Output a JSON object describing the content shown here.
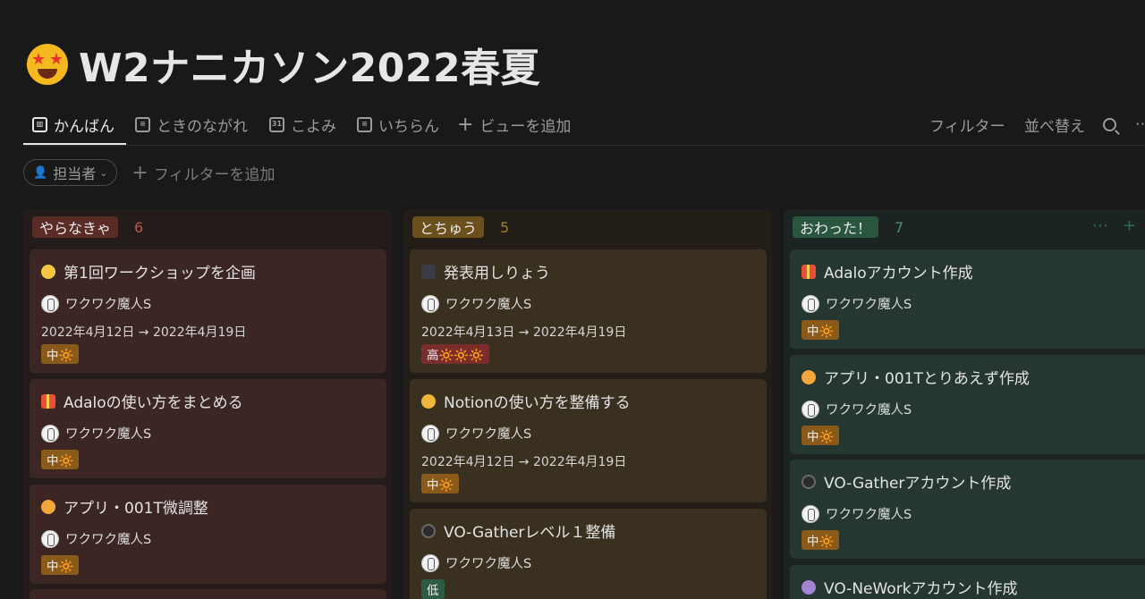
{
  "page": {
    "title": "W2ナニカソン2022春夏",
    "icon": "star-struck-emoji-icon"
  },
  "views": {
    "tabs": [
      {
        "label": "かんばん",
        "icon": "board-icon",
        "active": true
      },
      {
        "label": "ときのながれ",
        "icon": "timeline-icon"
      },
      {
        "label": "こよみ",
        "icon": "calendar-icon"
      },
      {
        "label": "いちらん",
        "icon": "list-icon"
      }
    ],
    "add_view": "ビューを追加",
    "filter": "フィルター",
    "sort": "並べ替え"
  },
  "filters": {
    "assignee": "担当者",
    "add_filter": "フィルターを追加"
  },
  "columns": [
    {
      "name": "やらなきゃ",
      "count": "6",
      "color": "#5a2b27",
      "count_color": "#b85a4a",
      "cards": [
        {
          "title": "第1回ワークショップを企画",
          "icon": "chick-icon",
          "assignee": "ワクワク魔人S",
          "date": "2022年4月12日 → 2022年4月19日",
          "priority": "中🔆"
        },
        {
          "title": "Adaloの使い方をまとめる",
          "icon": "gift-icon",
          "assignee": "ワクワク魔人S",
          "priority": "中🔆"
        },
        {
          "title": "アプリ・001T微調整",
          "icon": "smiling-face-icon",
          "assignee": "ワクワク魔人S",
          "priority": "中🔆"
        }
      ]
    },
    {
      "name": "とちゅう",
      "count": "5",
      "color": "#6b4f1d",
      "count_color": "#a67c2e",
      "cards": [
        {
          "title": "発表用しりょう",
          "icon": "tuxedo-icon",
          "assignee": "ワクワク魔人S",
          "date": "2022年4月13日 → 2022年4月19日",
          "priority": "高🔆🔆🔆"
        },
        {
          "title": "Notionの使い方を整備する",
          "icon": "face-with-monocle-icon",
          "assignee": "ワクワク魔人S",
          "date": "2022年4月12日 → 2022年4月19日",
          "priority": "中🔆"
        },
        {
          "title": "VO-Gatherレベル１整備",
          "icon": "goggles-icon",
          "assignee": "ワクワク魔人S",
          "priority": "低"
        }
      ]
    },
    {
      "name": "おわった！",
      "count": "7",
      "color": "#2a5640",
      "count_color": "#4c8f6e",
      "cards": [
        {
          "title": "Adaloアカウント作成",
          "icon": "gift-icon",
          "assignee": "ワクワク魔人S",
          "priority": "中🔆"
        },
        {
          "title": "アプリ・001Tとりあえず作成",
          "icon": "smiling-face-icon",
          "assignee": "ワクワク魔人S",
          "priority": "中🔆"
        },
        {
          "title": "VO-Gatherアカウント作成",
          "icon": "goggles-icon",
          "assignee": "ワクワク魔人S",
          "priority": "中🔆"
        },
        {
          "title": "VO-NeWorkアカウント作成",
          "icon": "purple-circle-icon"
        }
      ]
    }
  ],
  "colors": {
    "priority_mid": "#8a5a1b",
    "priority_high": "#7a2d2a",
    "priority_low": "#2d5b43"
  }
}
